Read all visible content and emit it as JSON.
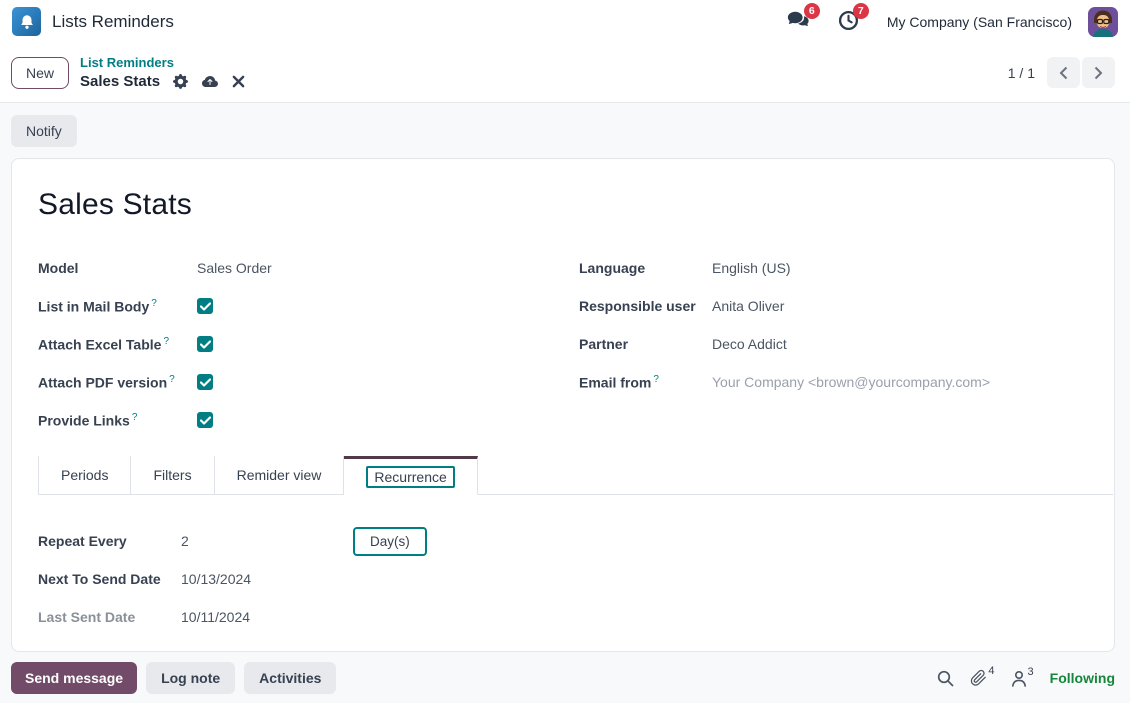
{
  "colors": {
    "accent_teal": "#017e84",
    "brand_purple": "#714b67",
    "active_tab_top": "#52394a",
    "badge_red": "#dc3545",
    "following_green": "#17863d",
    "app_icon_blue": "#2a7ab8",
    "page_bg": "#f8f9fa"
  },
  "navbar": {
    "app_title": "Lists Reminders",
    "messages_badge": "6",
    "activities_badge": "7",
    "company": "My Company (San Francisco)"
  },
  "breadcrumb": {
    "new_button": "New",
    "parent": "List Reminders",
    "current": "Sales Stats",
    "pager": "1 / 1"
  },
  "statusbar": {
    "notify_button": "Notify"
  },
  "form": {
    "title": "Sales Stats",
    "help_glyph": "?",
    "left_fields": [
      {
        "label": "Model",
        "value": "Sales Order"
      },
      {
        "label": "List in Mail Body",
        "checked": true
      },
      {
        "label": "Attach Excel Table",
        "checked": true
      },
      {
        "label": "Attach PDF version",
        "checked": true
      },
      {
        "label": "Provide Links",
        "checked": true
      }
    ],
    "right_fields": [
      {
        "label": "Language",
        "value": "English (US)"
      },
      {
        "label": "Responsible user",
        "value": "Anita Oliver"
      },
      {
        "label": "Partner",
        "value": "Deco Addict"
      },
      {
        "label": "Email from",
        "value": "Your Company <brown@yourcompany.com>"
      }
    ],
    "tabs": [
      {
        "label": "Periods",
        "active": false
      },
      {
        "label": "Filters",
        "active": false
      },
      {
        "label": "Remider view",
        "active": false
      },
      {
        "label": "Recurrence",
        "active": true
      }
    ],
    "recurrence": [
      {
        "label": "Repeat Every",
        "value": "2",
        "unit_button": "Day(s)"
      },
      {
        "label": "Next To Send Date",
        "value": "10/13/2024"
      },
      {
        "label": "Last Sent Date",
        "value": "10/11/2024"
      }
    ]
  },
  "chatter": {
    "send_message": "Send message",
    "log_note": "Log note",
    "activities": "Activities",
    "attachments_count": "4",
    "followers_count": "3",
    "following": "Following"
  }
}
